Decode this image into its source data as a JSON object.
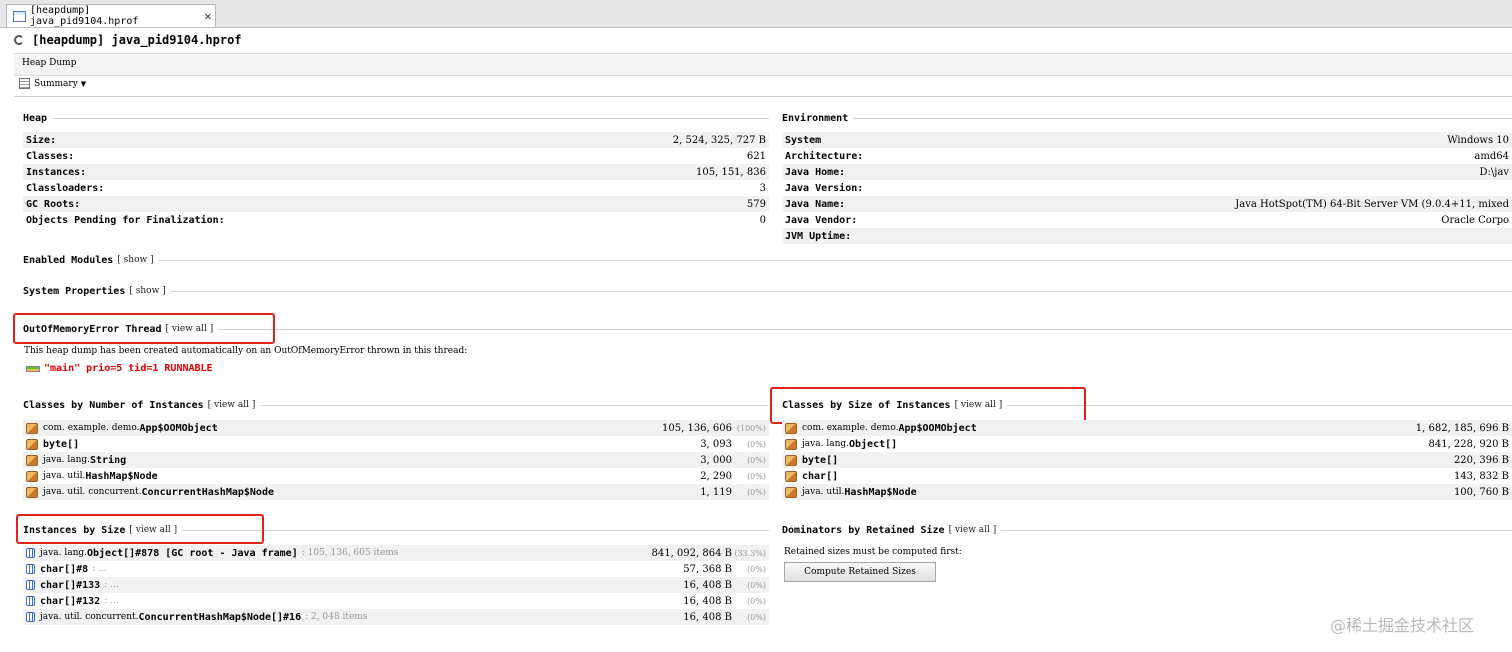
{
  "tab": {
    "label": "[heapdump] java_pid9104.hprof",
    "close": "✕"
  },
  "header": {
    "title": "[heapdump] java_pid9104.hprof"
  },
  "toolbar": {
    "heap_dump_label": "Heap Dump",
    "summary_label": "Summary",
    "summary_caret": "▼"
  },
  "heap": {
    "title": "Heap",
    "rows": [
      {
        "key": "Size:",
        "value": "2, 524, 325, 727 B"
      },
      {
        "key": "Classes:",
        "value": "621"
      },
      {
        "key": "Instances:",
        "value": "105, 151, 836"
      },
      {
        "key": "Classloaders:",
        "value": "3"
      },
      {
        "key": "GC Roots:",
        "value": "579"
      },
      {
        "key": "Objects Pending for Finalization:",
        "value": "0"
      }
    ]
  },
  "environment": {
    "title": "Environment",
    "rows": [
      {
        "key": "System",
        "value": "Windows 10"
      },
      {
        "key": "Architecture:",
        "value": "amd64"
      },
      {
        "key": "Java Home:",
        "value": "D:\\jav"
      },
      {
        "key": "Java Version:",
        "value": ""
      },
      {
        "key": "Java Name:",
        "value": "Java HotSpot(TM) 64-Bit Server VM (9.0.4+11, mixed"
      },
      {
        "key": "Java Vendor:",
        "value": "Oracle Corpo"
      },
      {
        "key": "JVM Uptime:",
        "value": ""
      }
    ]
  },
  "enabled_modules": {
    "title": "Enabled Modules",
    "link": "[ show ]"
  },
  "system_properties": {
    "title": "System Properties",
    "link": "[ show ]"
  },
  "oom_thread": {
    "title": "OutOfMemoryError Thread",
    "link": "[ view  all ]",
    "info": "This heap dump has been created automatically on an OutOfMemoryError thrown in this thread:",
    "thread": "\"main\" prio=5 tid=1 RUNNABLE"
  },
  "classes_by_number": {
    "title": "Classes by Number of Instances",
    "link": "[ view  all ]",
    "rows": [
      {
        "pkg": "com. example. demo. ",
        "cls": "App$OOMObject",
        "count": "105, 136, 606",
        "pct": "(100%)"
      },
      {
        "pkg": "",
        "cls": "byte[]",
        "count": "3, 093",
        "pct": "(0%)"
      },
      {
        "pkg": "java. lang. ",
        "cls": "String",
        "count": "3, 000",
        "pct": "(0%)"
      },
      {
        "pkg": "java. util. ",
        "cls": "HashMap$Node",
        "count": "2, 290",
        "pct": "(0%)"
      },
      {
        "pkg": "java. util. concurrent. ",
        "cls": "ConcurrentHashMap$Node",
        "count": "1, 119",
        "pct": "(0%)"
      }
    ]
  },
  "classes_by_size": {
    "title": "Classes by Size of Instances",
    "link": "[ view  all ]",
    "rows": [
      {
        "pkg": "com. example. demo. ",
        "cls": "App$OOMObject",
        "size": "1, 682, 185, 696 B"
      },
      {
        "pkg": "java. lang. ",
        "cls": "Object[]",
        "size": "841, 228, 920 B"
      },
      {
        "pkg": "",
        "cls": "byte[]",
        "size": "220, 396 B"
      },
      {
        "pkg": "",
        "cls": "char[]",
        "size": "143, 832 B"
      },
      {
        "pkg": "java. util. ",
        "cls": "HashMap$Node",
        "size": "100, 760 B"
      }
    ]
  },
  "instances_by_size": {
    "title": "Instances by Size",
    "link": "[ view  all ]",
    "rows": [
      {
        "pkg": "java. lang. ",
        "cls": "Object[]#878 [GC root - Java frame]",
        "extra": ": 105, 136, 605 items",
        "size": "841, 092, 864 B",
        "pct": "(33.3%)"
      },
      {
        "pkg": "",
        "cls": "char[]#8",
        "extra": ": ...",
        "size": "57, 368 B",
        "pct": "(0%)"
      },
      {
        "pkg": "",
        "cls": "char[]#133",
        "extra": ": ...",
        "size": "16, 408 B",
        "pct": "(0%)"
      },
      {
        "pkg": "",
        "cls": "char[]#132",
        "extra": ": ...",
        "size": "16, 408 B",
        "pct": "(0%)"
      },
      {
        "pkg": "java. util. concurrent. ",
        "cls": "ConcurrentHashMap$Node[]#16",
        "extra": ": 2, 048 items",
        "size": "16, 408 B",
        "pct": "(0%)"
      }
    ]
  },
  "dominators": {
    "title": "Dominators by Retained Size",
    "link": "[ view  all ]",
    "info": "Retained sizes must be computed first:",
    "button": "Compute Retained Sizes"
  },
  "watermark": "@稀土掘金技术社区"
}
